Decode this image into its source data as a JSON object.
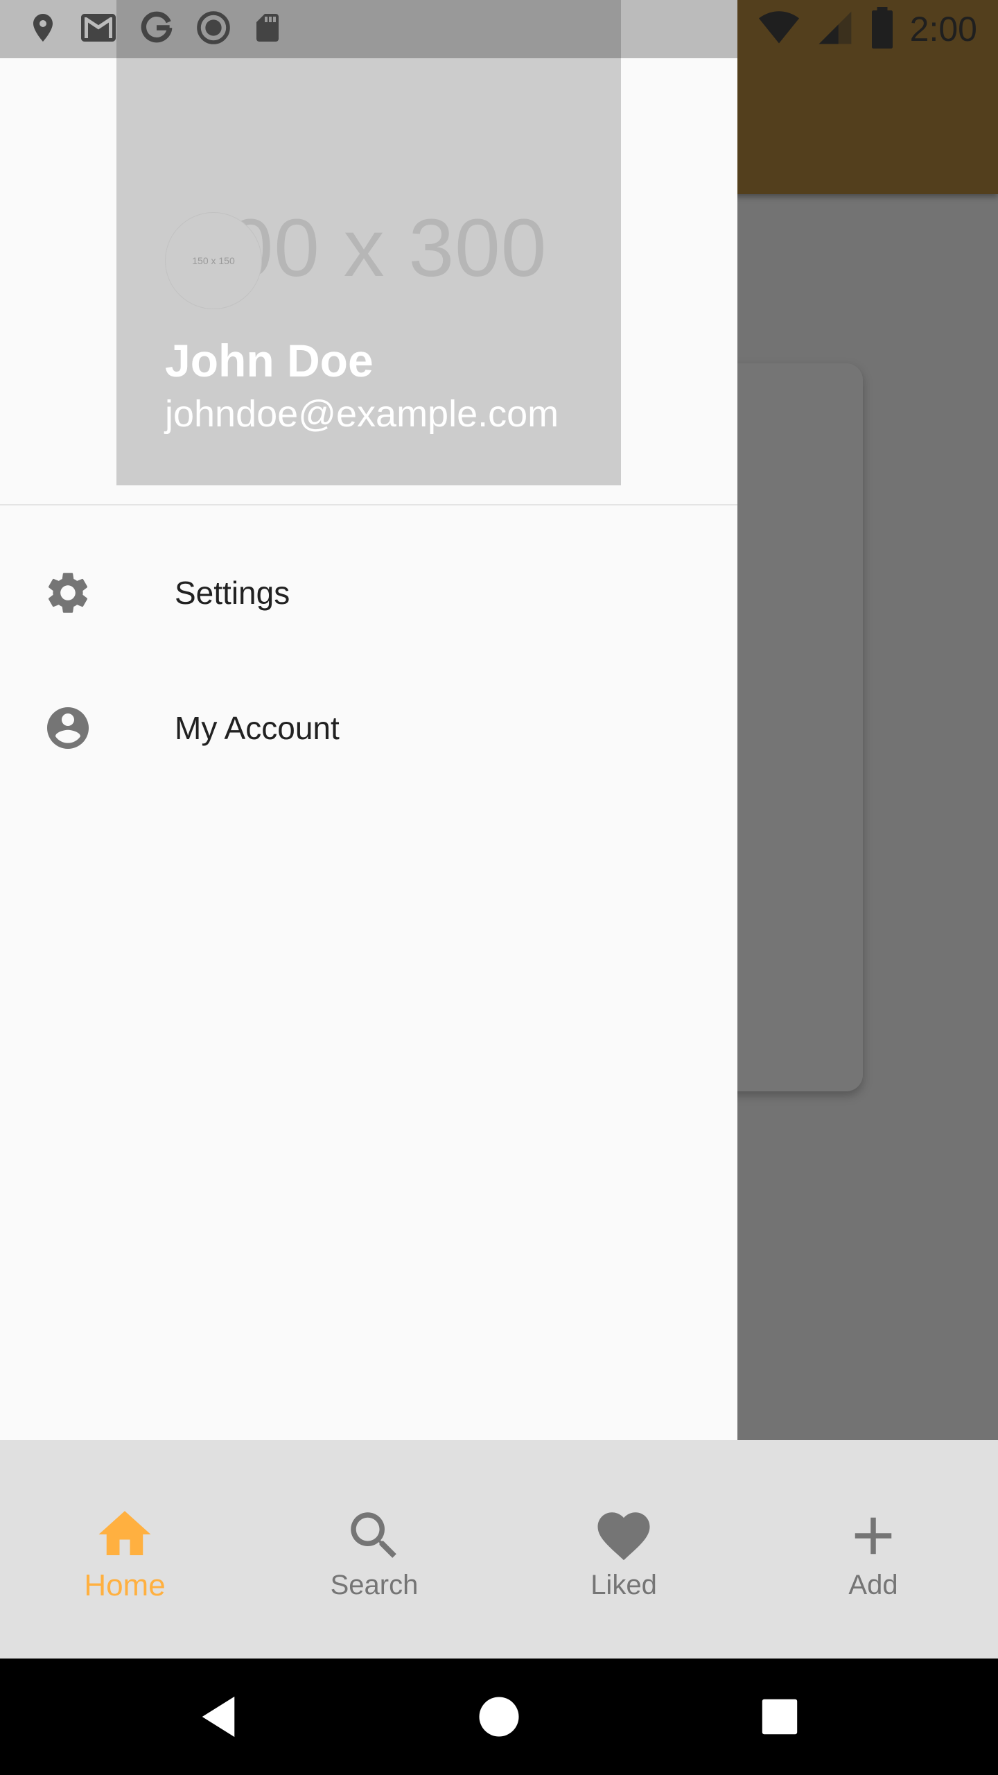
{
  "status_bar": {
    "time": "2:00",
    "left_icons": [
      "location-icon",
      "gmail-icon",
      "google-icon",
      "record-icon",
      "sd-card-icon"
    ],
    "right_icons": [
      "wifi-icon",
      "signal-icon",
      "battery-icon"
    ]
  },
  "drawer": {
    "header": {
      "background_placeholder": "600 x 300",
      "avatar_placeholder": "150 x 150",
      "name": "John Doe",
      "email": "johndoe@example.com"
    },
    "items": [
      {
        "label": "Settings",
        "icon": "gear-icon"
      },
      {
        "label": "My Account",
        "icon": "account-circle-icon"
      }
    ]
  },
  "bottom_nav": {
    "items": [
      {
        "label": "Home",
        "icon": "home-icon",
        "active": true
      },
      {
        "label": "Search",
        "icon": "search-icon",
        "active": false
      },
      {
        "label": "Liked",
        "icon": "heart-icon",
        "active": false
      },
      {
        "label": "Add",
        "icon": "plus-icon",
        "active": false
      }
    ]
  },
  "colors": {
    "accent": "#ffb040",
    "toolbar": "#b5893f",
    "header_bg": "#cccccc",
    "nav_bg": "#e0e0e0"
  }
}
